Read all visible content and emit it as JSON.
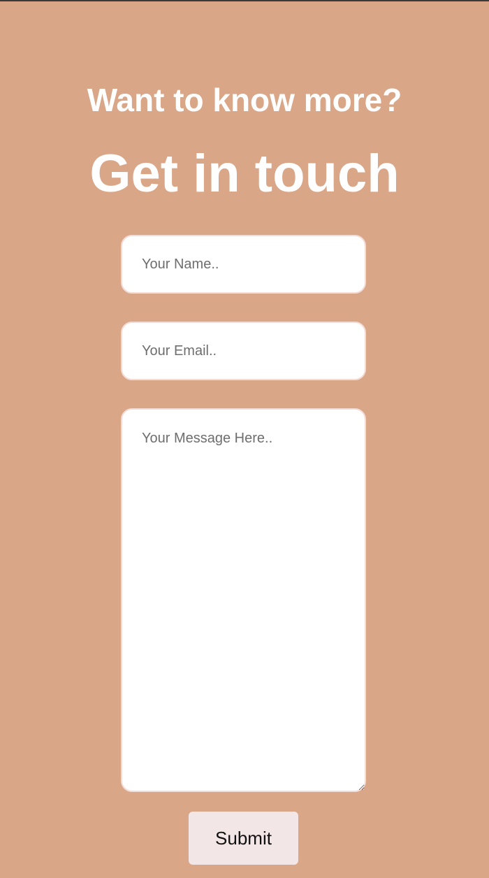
{
  "header": {
    "subheading": "Want to know more?",
    "heading": "Get in touch"
  },
  "form": {
    "name_placeholder": "Your Name..",
    "email_placeholder": "Your Email..",
    "message_placeholder": "Your Message Here..",
    "submit_label": "Submit"
  },
  "colors": {
    "background": "#d9a688",
    "text": "#ffffff",
    "button_bg": "#f2e6e6",
    "field_border": "#f3dcd6"
  }
}
